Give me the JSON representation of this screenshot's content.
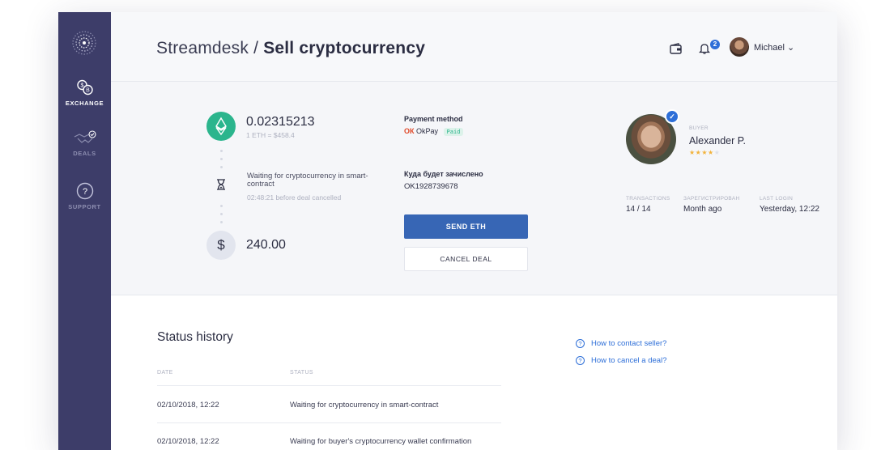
{
  "header": {
    "crumb": "Streamdesk",
    "separator": "/",
    "page_title": "Sell cryptocurrency",
    "notification_count": "2",
    "user_name": "Michael"
  },
  "sidebar": {
    "items": [
      {
        "label": "EXCHANGE",
        "icon": "exchange-icon",
        "active": true
      },
      {
        "label": "DEALS",
        "icon": "handshake-icon",
        "active": false
      },
      {
        "label": "SUPPORT",
        "icon": "help-icon",
        "active": false
      }
    ]
  },
  "deal": {
    "eth_amount": "0.02315213",
    "eth_rate": "1 ETH = $458.4",
    "wait_title": "Waiting for cryptocurrency in smart-contract",
    "wait_timer": "02:48:21 before deal cancelled",
    "usd_amount": "240.00",
    "usd_symbol": "$",
    "payment_label": "Payment method",
    "payment_logo": "ОК",
    "payment_name": "OkPay",
    "payment_status": "Paid",
    "credit_label": "Куда будет зачислено",
    "credit_value": "OK1928739678",
    "send_button": "SEND ETH",
    "cancel_button": "CANCEL DEAL"
  },
  "buyer": {
    "tag": "BUYER",
    "name": "Alexander P.",
    "rating": 4,
    "rating_max": 5,
    "stats": [
      {
        "label": "TRANSACTIONS",
        "value": "14 / 14"
      },
      {
        "label": "ЗАРЕГИСТРИРОВАН",
        "value": "Month ago"
      },
      {
        "label": "LAST LOGIN",
        "value": "Yesterday, 12:22"
      }
    ]
  },
  "history": {
    "title": "Status history",
    "columns": [
      "DATE",
      "STATUS"
    ],
    "rows": [
      {
        "date": "02/10/2018, 12:22",
        "status": "Waiting for cryptocurrency in smart-contract"
      },
      {
        "date": "02/10/2018, 12:22",
        "status": "Waiting for buyer's cryptocurrency wallet confirmation"
      }
    ]
  },
  "help": {
    "links": [
      "How to contact seller?",
      "How to cancel a deal?"
    ]
  },
  "colors": {
    "sidebar": "#3d3d69",
    "accent": "#3766b5",
    "eth": "#2bb58d",
    "link": "#2e6fd8"
  }
}
